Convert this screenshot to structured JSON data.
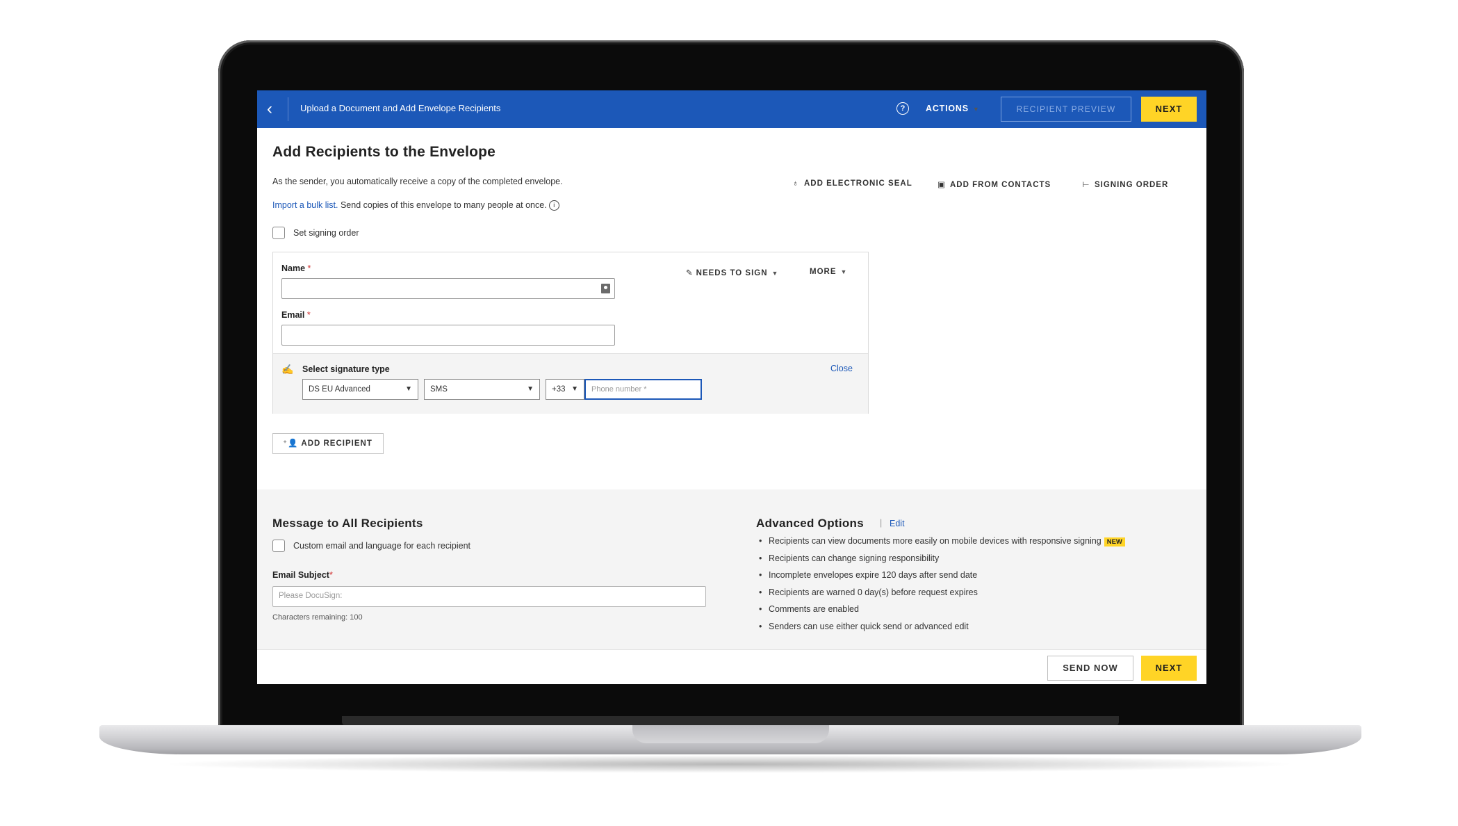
{
  "topbar": {
    "title": "Upload a Document and Add Envelope Recipients",
    "help_icon": "?",
    "actions_label": "ACTIONS",
    "preview_label": "RECIPIENT PREVIEW",
    "next_label": "NEXT"
  },
  "recipients": {
    "heading": "Add Recipients to the Envelope",
    "sender_note": "As the sender, you automatically receive a copy of the completed envelope.",
    "bulk_link": "Import a bulk list.",
    "bulk_text": " Send copies of this envelope to many people at once.",
    "tools": {
      "seal_label": "ADD ELECTRONIC SEAL",
      "contacts_label": "ADD FROM CONTACTS",
      "order_label": "SIGNING ORDER"
    },
    "signing_order_label": "Set signing order",
    "card": {
      "name_label": "Name",
      "email_label": "Email",
      "required_mark": "*",
      "name_value": "",
      "email_value": "",
      "role_label": "NEEDS TO SIGN",
      "more_label": "MORE",
      "sigtype_label": "Select signature type",
      "close_label": "Close",
      "sig_level": "DS EU Advanced",
      "auth_method": "SMS",
      "country_code": "+33",
      "phone_placeholder": "Phone number *"
    },
    "add_recipient_label": "ADD RECIPIENT"
  },
  "message": {
    "heading": "Message to All Recipients",
    "custom_label": "Custom email and language for each recipient",
    "subject_label": "Email Subject",
    "subject_required": "*",
    "subject_placeholder": "Please DocuSign:",
    "chars_remaining": "Characters remaining: 100"
  },
  "advanced": {
    "heading": "Advanced Options",
    "edit_label": "Edit",
    "items": [
      "Recipients can view documents more easily on mobile devices with responsive signing",
      "Recipients can change signing responsibility",
      "Incomplete envelopes expire 120 days after send date",
      "Recipients are warned 0 day(s) before request expires",
      "Comments are enabled",
      "Senders can use either quick send or advanced edit"
    ],
    "new_badge": "NEW"
  },
  "footer": {
    "send_now_label": "SEND NOW",
    "next_label": "NEXT"
  },
  "colors": {
    "brand_blue": "#1c58b8",
    "accent_yellow": "#ffd426"
  }
}
